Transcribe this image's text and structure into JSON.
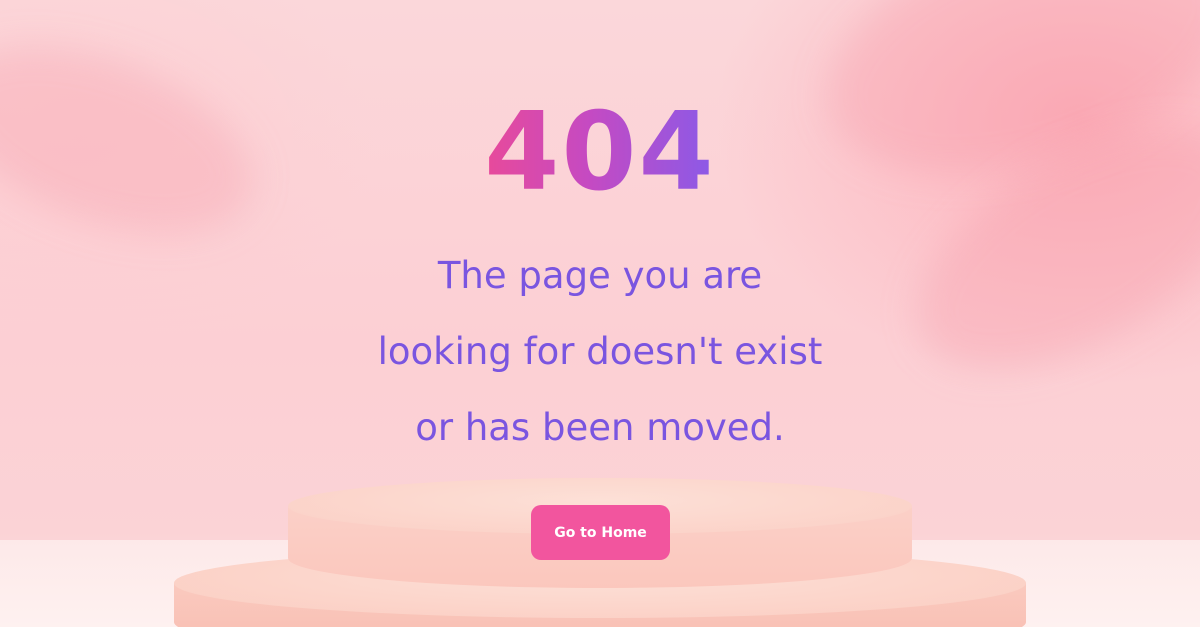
{
  "error_code": "404",
  "message_lines": [
    "The page you are",
    "looking for doesn't exist",
    "or has been moved."
  ],
  "home_button_label": "Go to Home",
  "colors": {
    "code_gradient_start": "#e84a9a",
    "code_gradient_end": "#8a5ae8",
    "message_text": "#7a55e0",
    "button_bg": "#f2559e",
    "button_text": "#ffffff",
    "background": "#fcd3d7"
  }
}
